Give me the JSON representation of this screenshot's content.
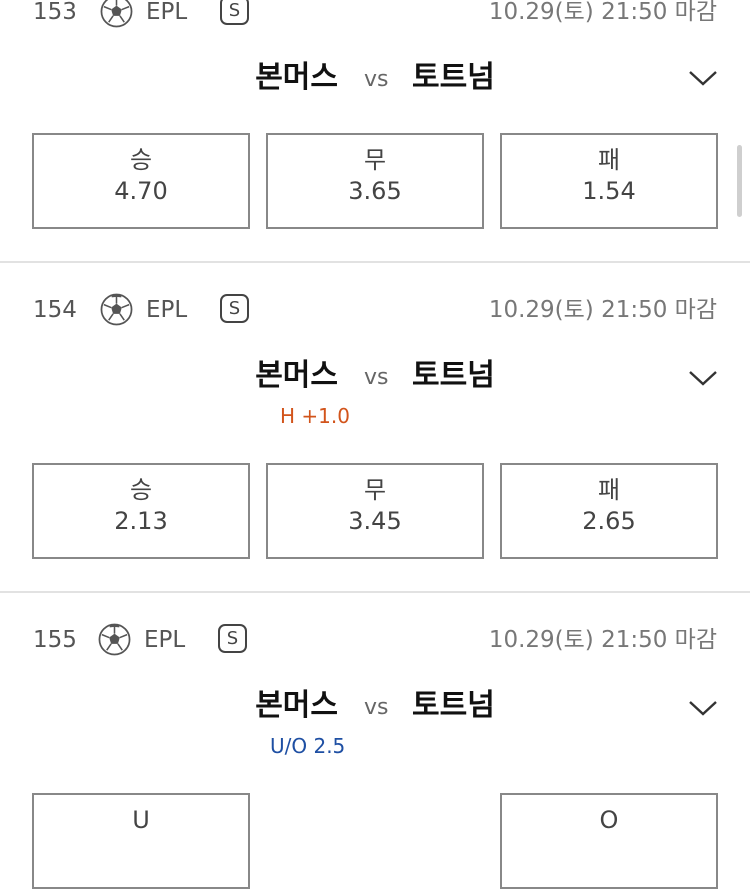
{
  "matches": [
    {
      "number": "153",
      "league": "EPL",
      "badge": "S",
      "deadline": "10.29(토) 21:50 마감",
      "home": "본머스",
      "vs": "vs",
      "away": "토트넘",
      "sub": "",
      "odds": [
        {
          "label": "승",
          "value": "4.70"
        },
        {
          "label": "무",
          "value": "3.65"
        },
        {
          "label": "패",
          "value": "1.54"
        }
      ]
    },
    {
      "number": "154",
      "league": "EPL",
      "badge": "S",
      "deadline": "10.29(토) 21:50 마감",
      "home": "본머스",
      "vs": "vs",
      "away": "토트넘",
      "sub": "H +1.0",
      "odds": [
        {
          "label": "승",
          "value": "2.13"
        },
        {
          "label": "무",
          "value": "3.45"
        },
        {
          "label": "패",
          "value": "2.65"
        }
      ]
    },
    {
      "number": "155",
      "league": "EPL",
      "badge": "S",
      "deadline": "10.29(토) 21:50 마감",
      "home": "본머스",
      "vs": "vs",
      "away": "토트넘",
      "sub": "U/O 2.5",
      "odds": [
        {
          "label": "U",
          "value": ""
        },
        {
          "label": "O",
          "value": ""
        }
      ]
    }
  ],
  "colors": {
    "handicap": "#d2541b",
    "under_over": "#1e4fa3",
    "separator": "#e2e2e2"
  },
  "icons": {
    "sport": "soccer-ball-icon",
    "expand": "chevron-down-icon",
    "special": "s-badge-icon"
  }
}
